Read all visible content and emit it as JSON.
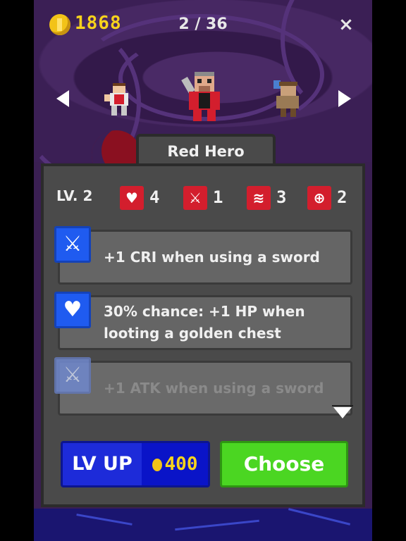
{
  "topbar": {
    "coins": "1868",
    "page_counter": "2 / 36",
    "close_label": "×"
  },
  "hero": {
    "name": "Red Hero",
    "level": "LV. 2"
  },
  "stats": [
    {
      "icon": "heart-icon",
      "glyph": "♥",
      "value": "4"
    },
    {
      "icon": "sword-icon",
      "glyph": "⚔",
      "value": "1"
    },
    {
      "icon": "speed-icon",
      "glyph": "≋",
      "value": "3"
    },
    {
      "icon": "crit-target-icon",
      "glyph": "⊕",
      "value": "2"
    }
  ],
  "skills": [
    {
      "icon": "sword-icon",
      "glyph": "⚔",
      "text": "+1 CRI when using a sword",
      "locked": false
    },
    {
      "icon": "heart-icon",
      "glyph": "♥",
      "text": "30% chance: +1 HP when looting a golden chest",
      "locked": false
    },
    {
      "icon": "sword-icon",
      "glyph": "⚔",
      "text": "+1 ATK when using a sword",
      "locked": true
    }
  ],
  "buttons": {
    "lvup_label": "LV UP",
    "lvup_cost": "400",
    "choose_label": "Choose"
  },
  "colors": {
    "stat_icon_bg": "#d31e2d",
    "skill_icon_bg": "#1f5bf0",
    "choose_bg": "#4bd622",
    "lvup_bg": "#1d2bd9",
    "coin_text": "#f7d31c"
  }
}
